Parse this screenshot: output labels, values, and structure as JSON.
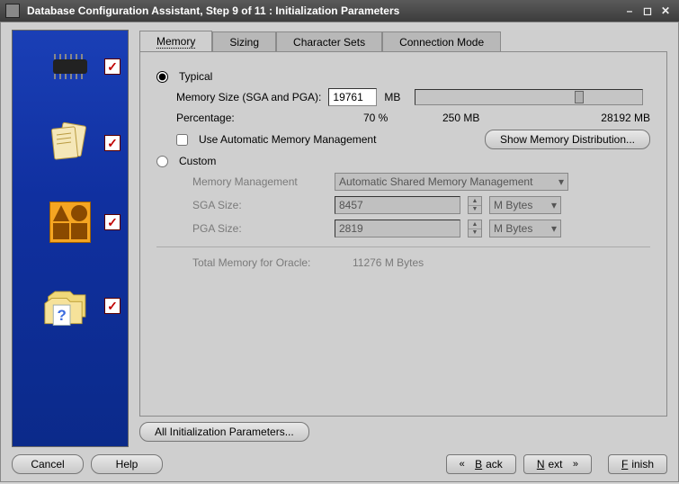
{
  "window": {
    "title": "Database Configuration Assistant, Step 9 of 11 : Initialization Parameters"
  },
  "tabs": {
    "memory": "Memory",
    "sizing": "Sizing",
    "charsets": "Character Sets",
    "connmode": "Connection Mode"
  },
  "memory": {
    "typical_label": "Typical",
    "mem_size_label": "Memory Size (SGA and PGA):",
    "mem_size_value": "19761",
    "mem_size_unit": "MB",
    "percentage_label": "Percentage:",
    "percentage_value": "70 %",
    "range_low": "250 MB",
    "range_high": "28192 MB",
    "use_amm_label": "Use Automatic Memory Management",
    "show_dist_label": "Show Memory Distribution...",
    "custom_label": "Custom",
    "mm_label": "Memory Management",
    "mm_value": "Automatic Shared Memory Management",
    "sga_label": "SGA Size:",
    "sga_value": "8457",
    "pga_label": "PGA Size:",
    "pga_value": "2819",
    "unit_mbytes": "M Bytes",
    "total_label": "Total Memory for Oracle:",
    "total_value": "11276 M Bytes"
  },
  "buttons": {
    "all_params": "All Initialization Parameters...",
    "cancel": "Cancel",
    "help": "Help",
    "back": "Back",
    "next": "Next",
    "finish": "Finish"
  }
}
